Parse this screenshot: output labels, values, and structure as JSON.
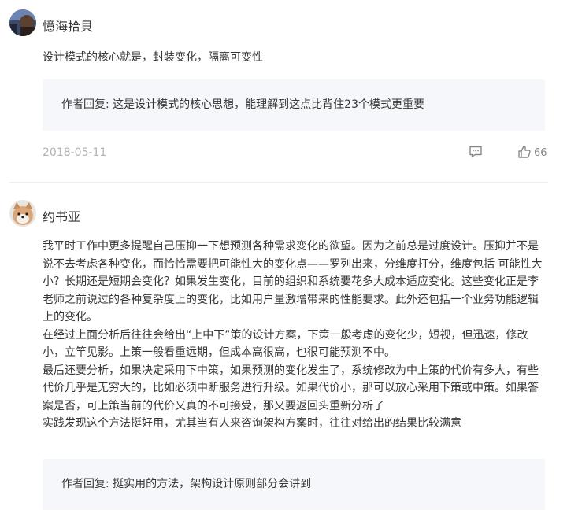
{
  "comments": [
    {
      "username": "憶海拾貝",
      "content": "设计模式的核心就是，封装变化，隔离可变性",
      "reply": "作者回复: 这是设计模式的核心思想，能理解到这点比背住23个模式更重要",
      "date": "2018-05-11",
      "likes": "66"
    },
    {
      "username": "约书亚",
      "paragraphs": [
        "我平时工作中更多提醒自己压抑一下想预测各种需求变化的欲望。因为之前总是过度设计。压抑并不是说不去考虑各种变化，而恰恰需要把可能性大的变化点——罗列出来，分维度打分，维度包括 可能性大小？长期还是短期会变化？如果发生变化，目前的组织和系统要花多大成本适应变化。这些变化正是李老师之前说过的各种复杂度上的变化，比如用户量激增带来的性能要求。此外还包括一个业务功能逻辑上的变化。",
        "在经过上面分析后往往会给出“上中下”策的设计方案，下策一般考虑的变化少，短视，但迅速，修改小，立竿见影。上策一般看重远期，但成本高很高，也很可能预测不中。",
        "最后还要分析，如果决定采用下中策，如果预测的变化发生了，系统修改为中上策的代价有多大，有些代价几乎是无穷大的，比如必须中断服务进行升级。如果代价小，那可以放心采用下策或中策。如果答案是否，可上策当前的代价又真的不可接受，那又要返回头重新分析了",
        "实践发现这个方法挺好用，尤其当有人来咨询架构方案时，往往对给出的结果比较满意"
      ],
      "reply": "作者回复: 挺实用的方法，架构设计原则部分会讲到"
    }
  ]
}
